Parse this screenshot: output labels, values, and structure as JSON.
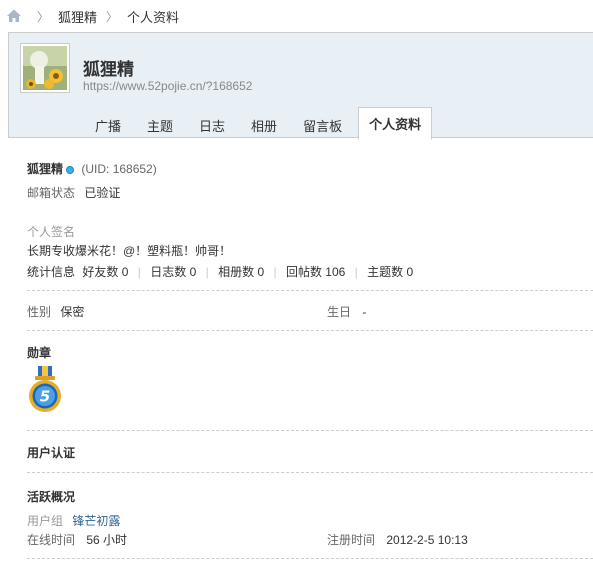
{
  "breadcrumb": {
    "items": [
      "狐狸精",
      "个人资料"
    ]
  },
  "header": {
    "username": "狐狸精",
    "url": "https://www.52pojie.cn/?168652",
    "tabs": [
      "广播",
      "主题",
      "日志",
      "相册",
      "留言板",
      "个人资料"
    ],
    "active_tab": "个人资料"
  },
  "profile": {
    "name": "狐狸精",
    "uid": "(UID: 168652)",
    "email_label": "邮箱状态",
    "email_value": "已验证",
    "signature_label": "个人签名",
    "signature": "长期专收爆米花！@！塑料瓶！帅哥！",
    "stats_label": "统计信息",
    "stats": [
      {
        "label": "好友数",
        "value": "0"
      },
      {
        "label": "日志数",
        "value": "0"
      },
      {
        "label": "相册数",
        "value": "0"
      },
      {
        "label": "回帖数",
        "value": "106"
      },
      {
        "label": "主题数",
        "value": "0"
      }
    ],
    "gender_label": "性别",
    "gender_value": "保密",
    "birthday_label": "生日",
    "birthday_value": "-",
    "medals_title": "勋章",
    "medal_text": "5",
    "verify_title": "用户认证",
    "activity_title": "活跃概况",
    "group_label": "用户组",
    "group_value": "锋芒初露",
    "online_label": "在线时间",
    "online_value": "56 小时",
    "reg_label": "注册时间",
    "reg_value": "2012-2-5 10:13"
  },
  "colors": {
    "header_bg": "#e8eff5",
    "link": "#336699",
    "online_dot": "#3cb0e6"
  }
}
